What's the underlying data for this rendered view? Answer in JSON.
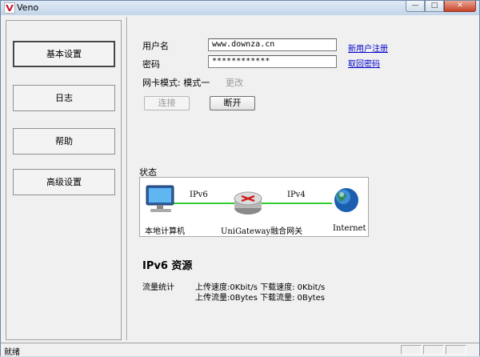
{
  "window": {
    "title": "Veno",
    "controls": {
      "minimize": "—",
      "maximize": "□",
      "close": "✕"
    }
  },
  "sidebar": {
    "items": [
      {
        "label": "基本设置",
        "active": true
      },
      {
        "label": "日志",
        "active": false
      },
      {
        "label": "帮助",
        "active": false
      },
      {
        "label": "高级设置",
        "active": false
      }
    ]
  },
  "login": {
    "username_label": "用户名",
    "username_value": "www.downza.cn",
    "password_label": "密码",
    "password_value": "************",
    "register_link": "新用户注册",
    "retrieve_link": "取回密码",
    "mode_label": "网卡模式: 模式一",
    "change_label": "更改",
    "connect_button": "连接",
    "disconnect_button": "断开"
  },
  "status": {
    "heading": "状态",
    "local_label": "本地计算机",
    "gateway_label": "UniGateway融合网关",
    "internet_label": "Internet",
    "link1_label": "IPv6",
    "link2_label": "IPv4",
    "link_color": "#33cc33"
  },
  "ipv6": {
    "title": "IPv6 资源",
    "traffic_label": "流量统计",
    "speed_line": "上传速度:0Kbit/s 下载速度: 0Kbit/s",
    "volume_line": "上传流量:0Bytes 下载流量: 0Bytes"
  },
  "statusbar": {
    "text": "就绪"
  },
  "icons": {
    "app": "veno-logo-icon",
    "computer": "computer-monitor-icon",
    "router": "router-icon",
    "globe": "globe-icon"
  }
}
